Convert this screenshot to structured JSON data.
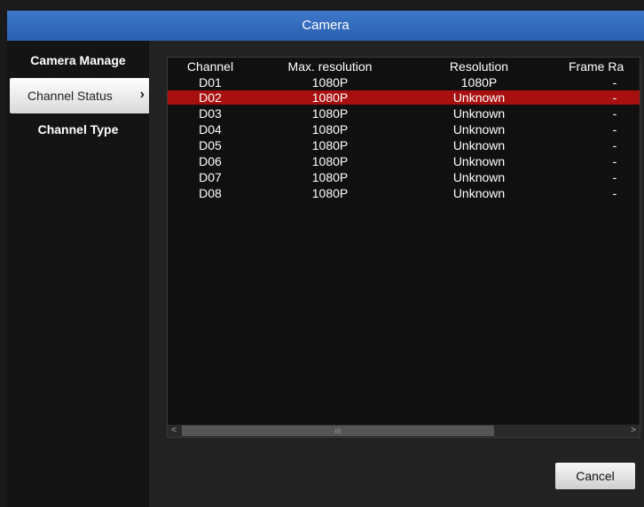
{
  "window": {
    "title": "Camera"
  },
  "sidebar": {
    "items": [
      {
        "label": "Camera Manage"
      },
      {
        "label": "Channel Status",
        "chevron": "›"
      },
      {
        "label": "Channel Type"
      }
    ]
  },
  "table": {
    "headers": [
      "Channel",
      "Max. resolution",
      "Resolution",
      "Frame Ra"
    ],
    "rows": [
      [
        "D01",
        "1080P",
        "1080P",
        "-"
      ],
      [
        "D02",
        "1080P",
        "Unknown",
        "-"
      ],
      [
        "D03",
        "1080P",
        "Unknown",
        "-"
      ],
      [
        "D04",
        "1080P",
        "Unknown",
        "-"
      ],
      [
        "D05",
        "1080P",
        "Unknown",
        "-"
      ],
      [
        "D06",
        "1080P",
        "Unknown",
        "-"
      ],
      [
        "D07",
        "1080P",
        "Unknown",
        "-"
      ],
      [
        "D08",
        "1080P",
        "Unknown",
        "-"
      ]
    ],
    "selected_row_index": 1
  },
  "scrollbar": {
    "left_arrow": "<",
    "right_arrow": ">",
    "grip": "ılı"
  },
  "buttons": {
    "cancel": "Cancel"
  },
  "colors": {
    "title_bar": "#3c78c8",
    "selected_row": "#a81010",
    "active_sidebar": "#f0f0f0"
  }
}
